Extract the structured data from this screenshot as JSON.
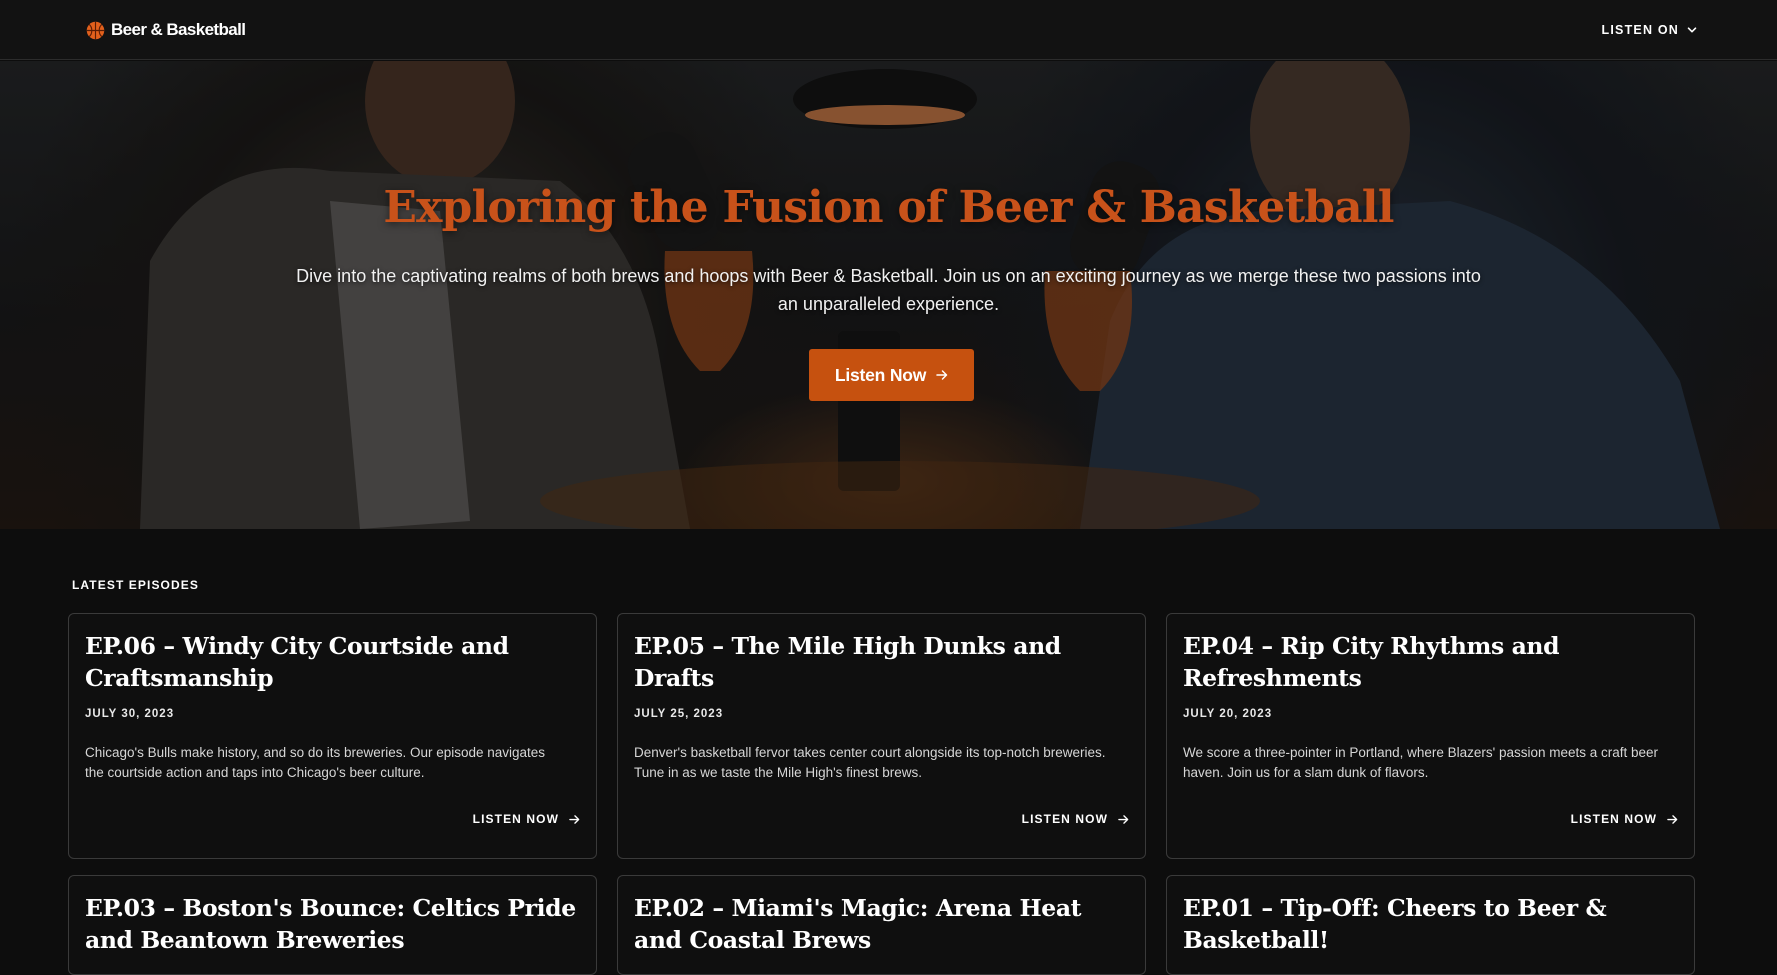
{
  "header": {
    "brand_name": "Beer & Basketball",
    "brand_icon": "basketball-icon",
    "listen_on_label": "LISTEN ON",
    "listen_on_icon": "chevron-down-icon"
  },
  "hero": {
    "title": "Exploring the Fusion of Beer & Basketball",
    "subtitle": "Dive into the captivating realms of both brews and hoops with Beer & Basketball. Join us on an exciting journey as we merge these two passions into an unparalleled experience.",
    "cta_label": "Listen Now",
    "cta_icon": "arrow-right-icon"
  },
  "colors": {
    "accent": "#c6510f",
    "title": "#c8521a",
    "background": "#0d0d0d",
    "card_border": "#3a3a3a"
  },
  "episodes_section": {
    "label": "LATEST EPISODES",
    "listen_label": "LISTEN NOW",
    "episodes": [
      {
        "title": "EP.06 – Windy City Courtside and Craftsmanship",
        "date": "JULY 30, 2023",
        "description": "Chicago's Bulls make history, and so do its breweries. Our episode navigates the courtside action and taps into Chicago's beer culture."
      },
      {
        "title": "EP.05 – The Mile High Dunks and Drafts",
        "date": "JULY 25, 2023",
        "description": "Denver's basketball fervor takes center court alongside its top-notch breweries. Tune in as we taste the Mile High's finest brews."
      },
      {
        "title": "EP.04 – Rip City Rhythms and Refreshments",
        "date": "JULY 20, 2023",
        "description": "We score a three-pointer in Portland, where Blazers' passion meets a craft beer haven. Join us for a slam dunk of flavors."
      },
      {
        "title": "EP.03 – Boston's Bounce: Celtics Pride and Beantown Breweries"
      },
      {
        "title": "EP.02 – Miami's Magic: Arena Heat and Coastal Brews"
      },
      {
        "title": "EP.01 – Tip-Off: Cheers to Beer & Basketball!"
      }
    ]
  }
}
